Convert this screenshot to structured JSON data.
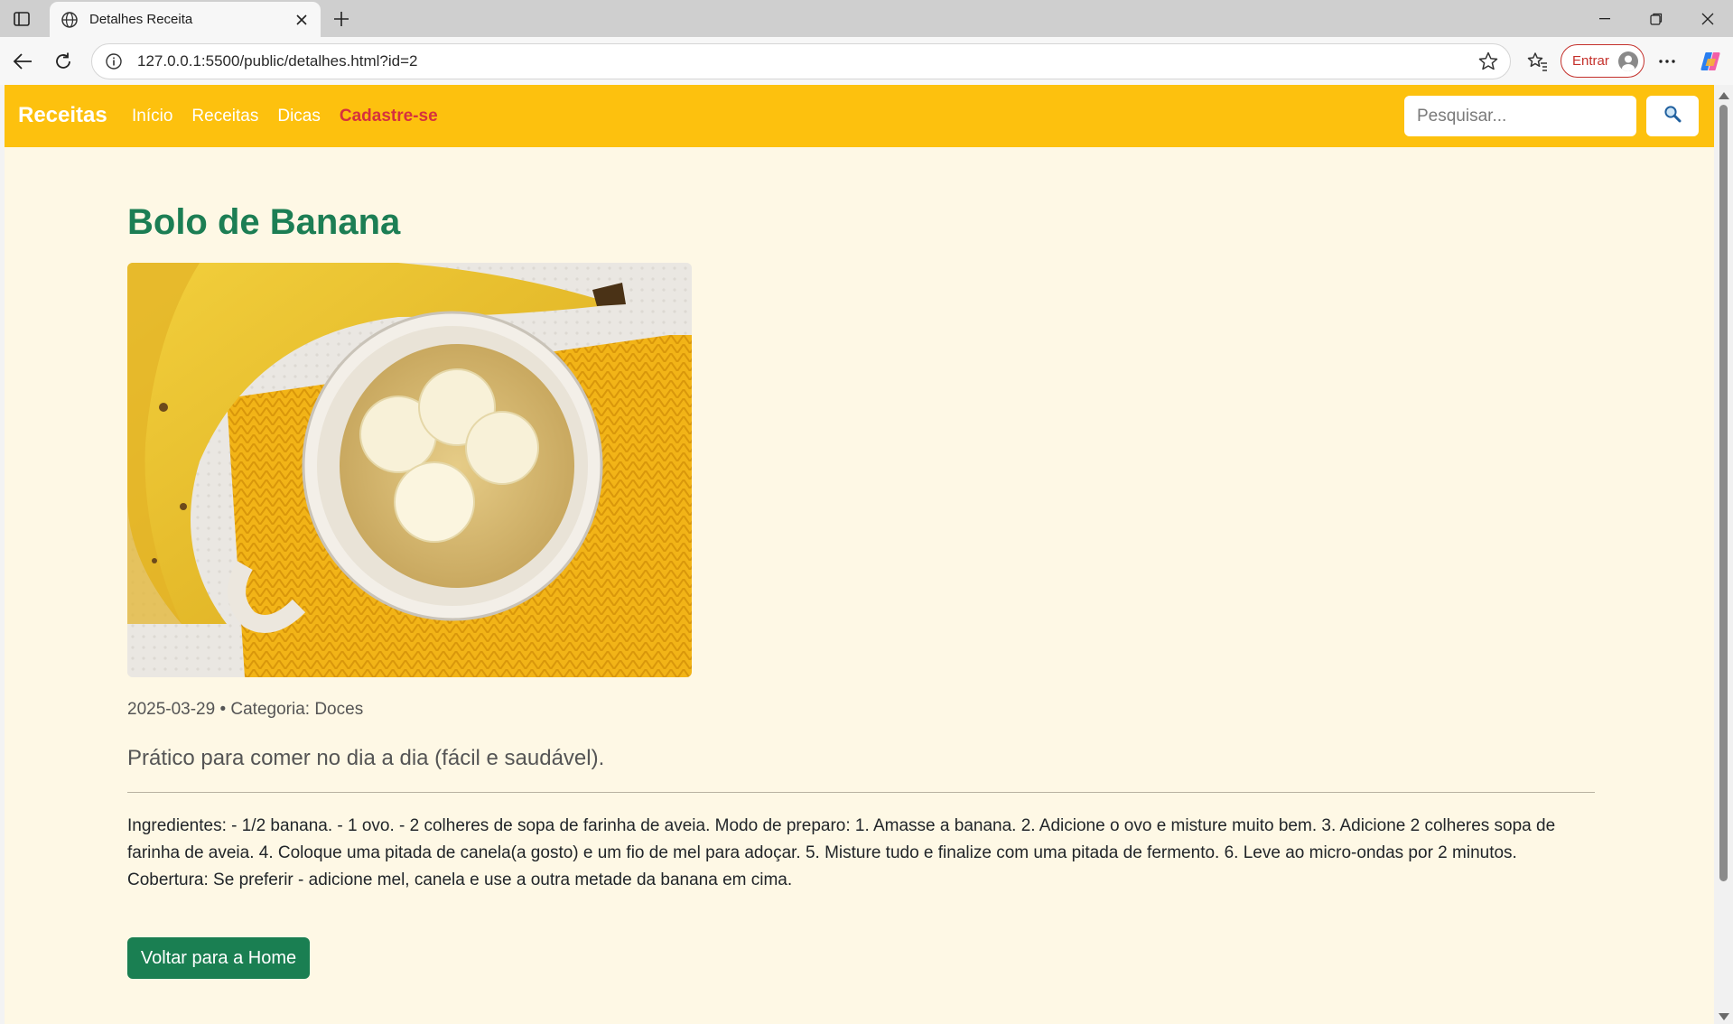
{
  "browser": {
    "tab_title": "Detalhes Receita",
    "url": "127.0.0.1:5500/public/detalhes.html?id=2",
    "profile_button_label": "Entrar",
    "icons": [
      "sidebar-toggle-icon",
      "globe-icon",
      "close-icon",
      "plus-icon",
      "minimize-icon",
      "restore-icon",
      "window-close-icon",
      "back-icon",
      "reload-icon",
      "info-icon",
      "star-icon",
      "favorites-icon",
      "more-icon",
      "copilot-icon"
    ]
  },
  "navbar": {
    "brand": "Receitas",
    "links": [
      {
        "label": "Início"
      },
      {
        "label": "Receitas"
      },
      {
        "label": "Dicas"
      },
      {
        "label": "Cadastre-se"
      }
    ],
    "search_placeholder": "Pesquisar...",
    "accent_color": "#fdc10e",
    "highlight_link_color": "#d6313e"
  },
  "recipe": {
    "title": "Bolo de Banana",
    "image_alt": "banana-mug-cake",
    "meta": "2025-03-29 • Categoria: Doces",
    "lead": "Prático para comer no dia a dia (fácil e saudável).",
    "body": "Ingredientes: - 1/2 banana. - 1 ovo. - 2 colheres de sopa de farinha de aveia. Modo de preparo: 1. Amasse a banana. 2. Adicione o ovo e misture muito bem. 3. Adicione 2 colheres sopa de farinha de aveia. 4. Coloque uma pitada de canela(a gosto) e um fio de mel para adoçar. 5. Misture tudo e finalize com uma pitada de fermento. 6. Leve ao micro-ondas por 2 minutos. Cobertura: Se preferir - adicione mel, canela e use a outra metade da banana em cima.",
    "back_button": "Voltar para a Home",
    "title_color": "#1c7e54"
  }
}
